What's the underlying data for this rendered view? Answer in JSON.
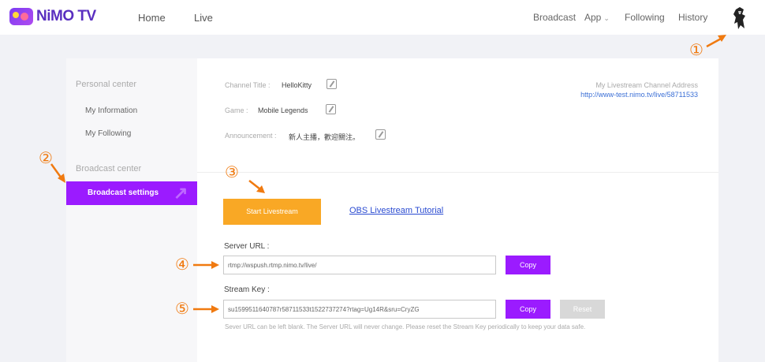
{
  "brand": {
    "name": "NiMO TV"
  },
  "nav": {
    "home": "Home",
    "live": "Live",
    "broadcast": "Broadcast",
    "app": "App",
    "following": "Following",
    "history": "History"
  },
  "callouts": [
    "①",
    "②",
    "③",
    "④",
    "⑤"
  ],
  "sidebar": {
    "personal_center": "Personal center",
    "my_information": "My Information",
    "my_following": "My Following",
    "broadcast_center": "Broadcast center",
    "broadcast_settings": "Broadcast settings"
  },
  "channel": {
    "title_label": "Channel Title :",
    "title_value": "HelloKitty",
    "game_label": "Game :",
    "game_value": "Mobile Legends",
    "announcement_label": "Announcement :",
    "announcement_value": "新人主播，歡迎關注。",
    "address_label": "My Livestream Channel Address",
    "address_link": "http://www-test.nimo.tv/live/58711533"
  },
  "actions": {
    "start_livestream": "Start Livestream",
    "obs_tutorial": "OBS Livestream Tutorial"
  },
  "server": {
    "label": "Server URL :",
    "value": "rtmp://wspush.rtmp.nimo.tv/live/",
    "copy": "Copy"
  },
  "stream_key": {
    "label": "Stream Key :",
    "value": "su1599511640787r58711533t1522737274?rtag=Ug14R&sru=CryZG",
    "copy": "Copy",
    "reset": "Reset"
  },
  "hint": "Sever URL can be left blank. The Server URL will never change. Please reset the Stream Key periodically to keep your data safe.",
  "colors": {
    "accent": "#9b1bff",
    "start_button": "#f9a825",
    "callout": "#f07a10",
    "link": "#2a4bd1"
  }
}
